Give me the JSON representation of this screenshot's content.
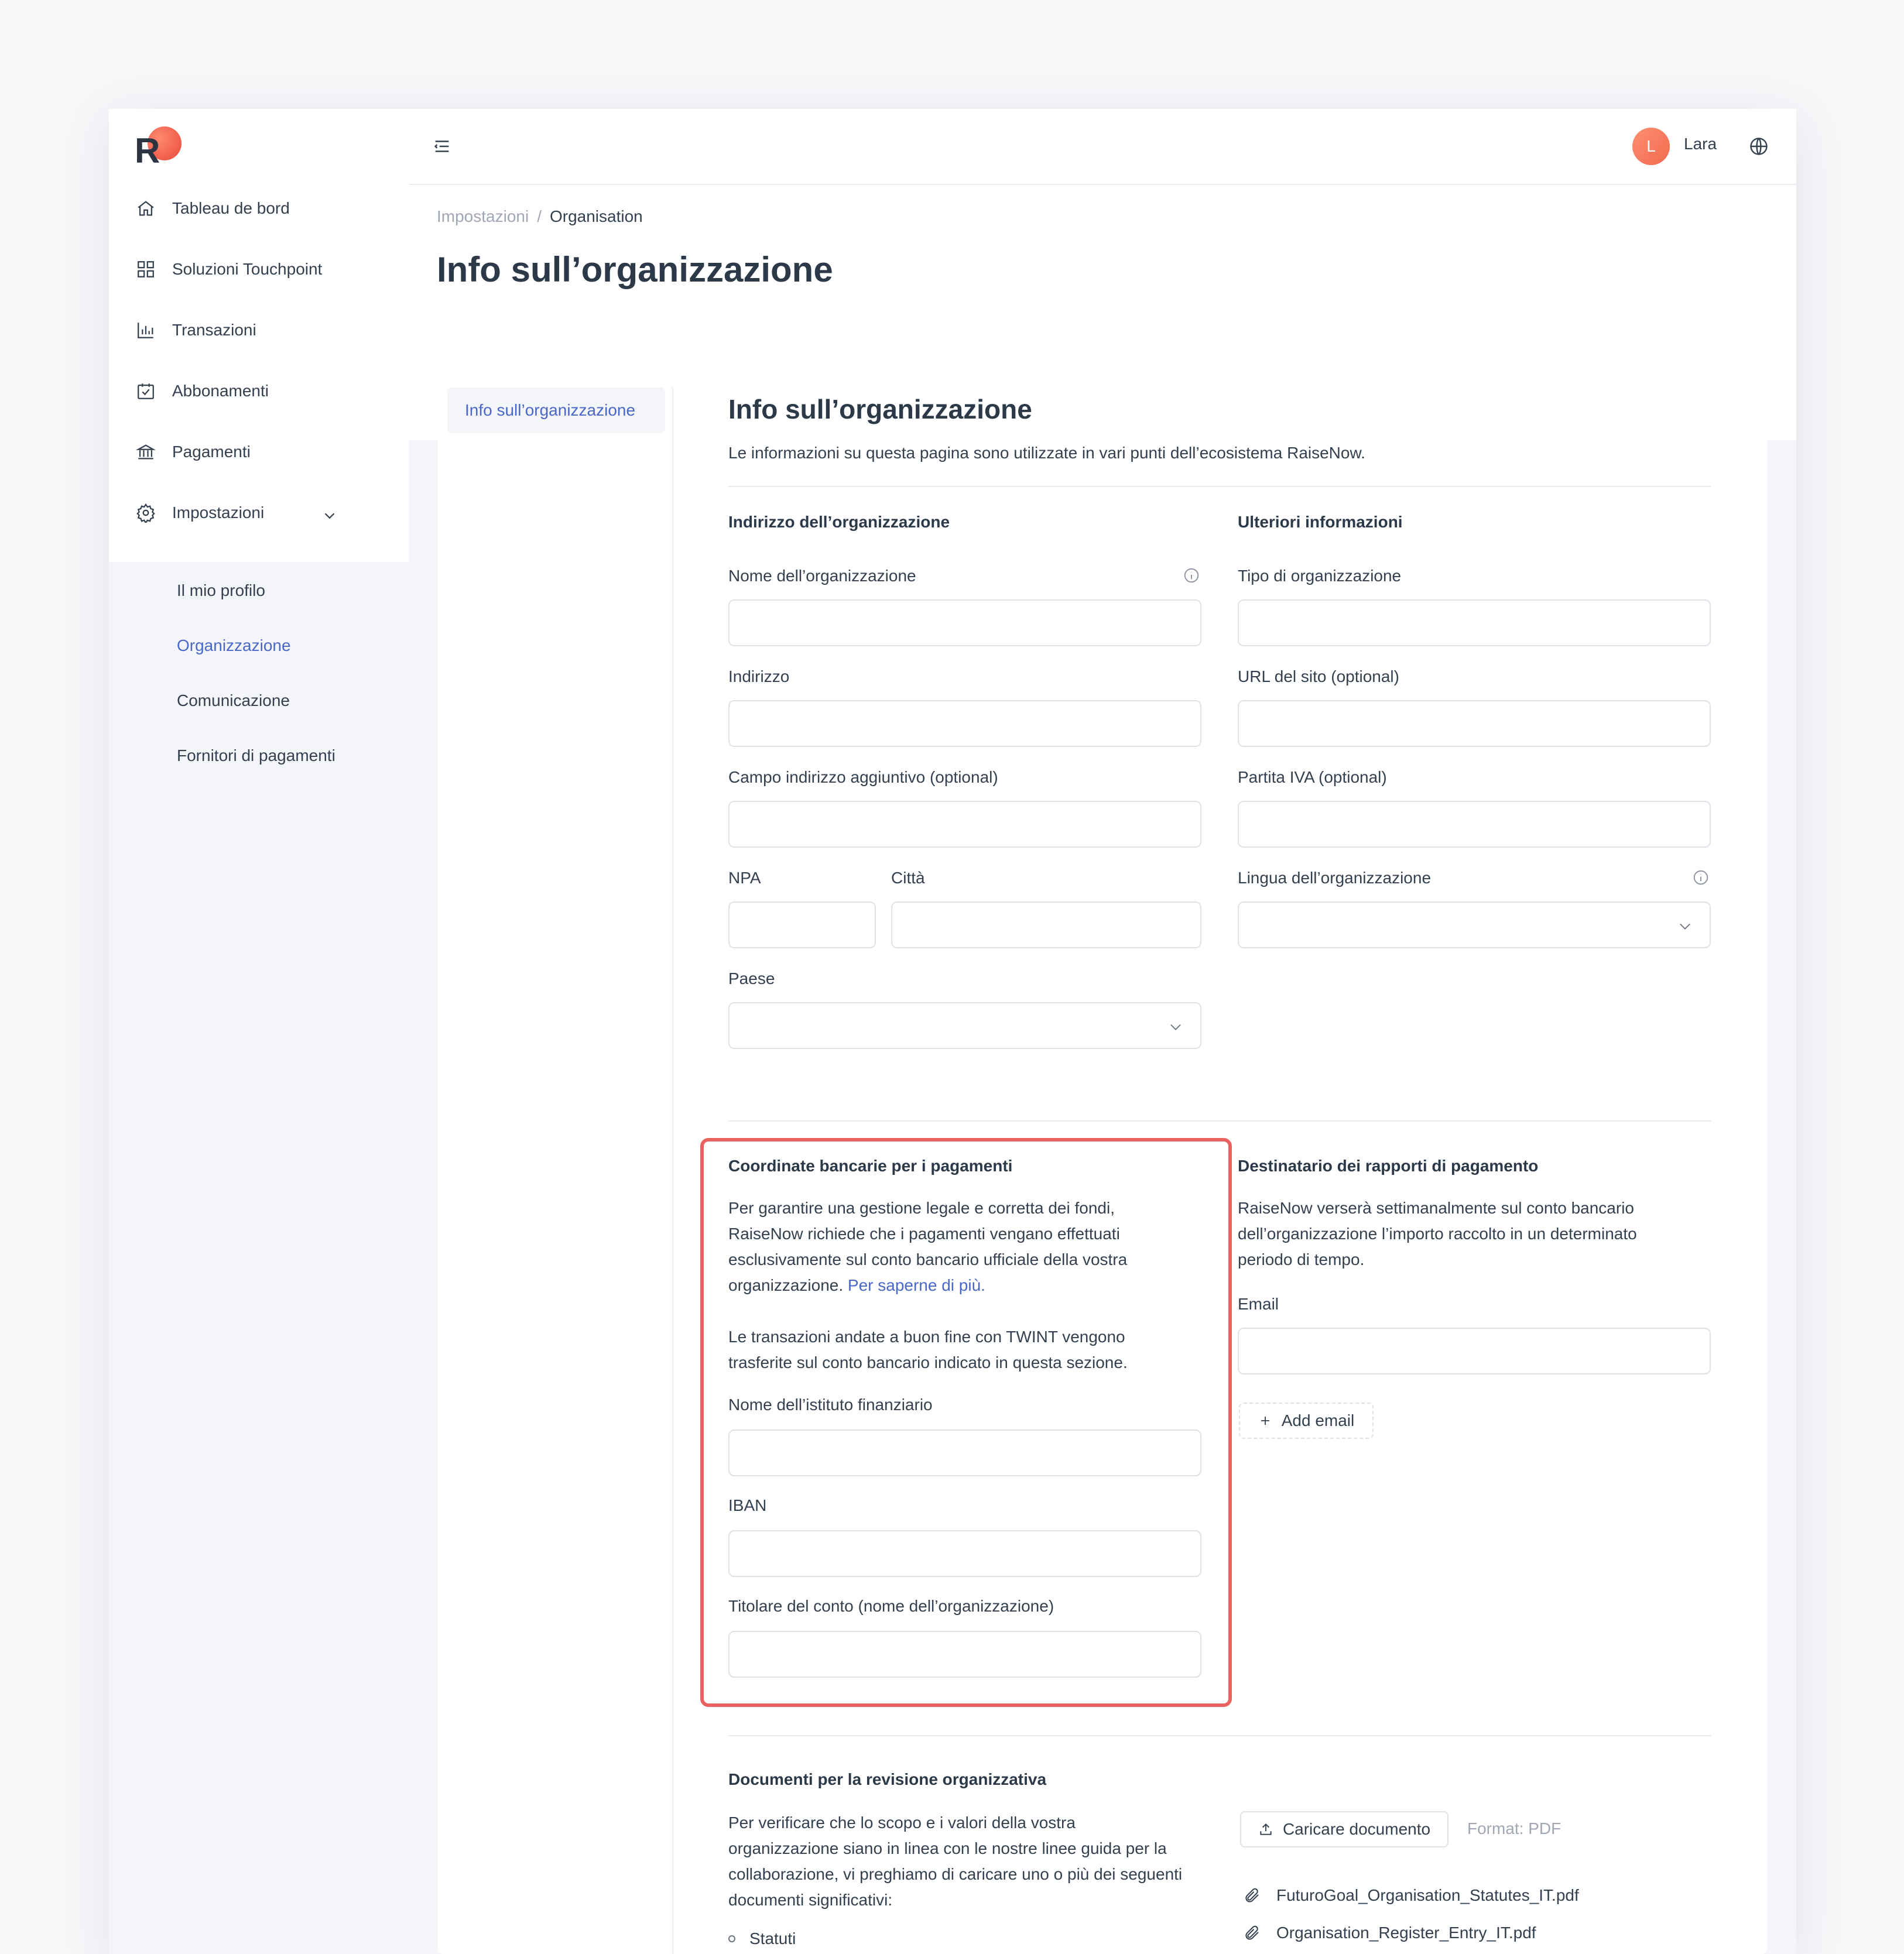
{
  "colors": {
    "accent": "#4a67c8",
    "highlight": "#e96160",
    "brand_gradient": [
      "#ff8a70",
      "#e8493b"
    ]
  },
  "logo": {
    "letter": "R"
  },
  "sidebar": {
    "items": [
      {
        "label": "Tableau de bord",
        "icon": "home-icon"
      },
      {
        "label": "Soluzioni Touchpoint",
        "icon": "grid-icon"
      },
      {
        "label": "Transazioni",
        "icon": "bar-chart-icon"
      },
      {
        "label": "Abbonamenti",
        "icon": "calendar-check-icon"
      },
      {
        "label": "Pagamenti",
        "icon": "bank-icon"
      },
      {
        "label": "Impostazioni",
        "icon": "gear-icon"
      }
    ],
    "sub_items": [
      {
        "label": "Il mio profilo"
      },
      {
        "label": "Organizzazione"
      },
      {
        "label": "Comunicazione"
      },
      {
        "label": "Fornitori di pagamenti"
      }
    ]
  },
  "topbar": {
    "avatar_initial": "L",
    "username": "Lara"
  },
  "breadcrumb": {
    "parent": "Impostazioni",
    "separator": "/",
    "current": "Organisation"
  },
  "page_title": "Info sull’organizzazione",
  "subnav": {
    "active": "Info sull’organizzazione"
  },
  "section": {
    "title": "Info sull’organizzazione",
    "description": "Le informazioni su questa pagina sono utilizzate in vari punti dell’ecosistema RaiseNow."
  },
  "address": {
    "heading": "Indirizzo dell’organizzazione",
    "name_label": "Nome dell’organizzazione",
    "address_label": "Indirizzo",
    "address2_label": "Campo indirizzo aggiuntivo (optional)",
    "zip_label": "NPA",
    "city_label": "Città",
    "country_label": "Paese"
  },
  "more_info": {
    "heading": "Ulteriori informazioni",
    "type_label": "Tipo di organizzazione",
    "url_label": "URL del sito (optional)",
    "vat_label": "Partita IVA (optional)",
    "language_label": "Lingua dell’organizzazione"
  },
  "bank": {
    "heading": "Coordinate bancarie per i pagamenti",
    "para1_lines": [
      "Per garantire una gestione legale e corretta dei fondi,",
      "RaiseNow richiede che i pagamenti vengano effettuati",
      "esclusivamente sul conto bancario ufficiale della vostra",
      "organizzazione."
    ],
    "learn_more": "Per saperne di più.",
    "para2_lines": [
      "Le transazioni andate a buon fine con TWINT vengono",
      "trasferite sul conto bancario indicato in questa sezione."
    ],
    "institution_label": "Nome dell’istituto finanziario",
    "iban_label": "IBAN",
    "holder_label": "Titolare del conto (nome dell’organizzazione)"
  },
  "reports": {
    "heading": "Destinatario dei rapporti di pagamento",
    "para_lines": [
      "RaiseNow verserà settimanalmente sul conto bancario",
      "dell’organizzazione l’importo raccolto in un determinato",
      "periodo di tempo."
    ],
    "email_label": "Email",
    "add_email": "Add email"
  },
  "documents": {
    "heading": "Documenti per la revisione organizzativa",
    "para_lines": [
      "Per verificare che lo scopo e i valori della vostra",
      "organizzazione siano in linea con le nostre linee guida per la",
      "collaborazione, vi preghiamo di caricare uno o più dei seguenti",
      "documenti significativi:"
    ],
    "bullet": "Statuti",
    "upload": "Caricare documento",
    "format": "Format: PDF",
    "files": [
      "FuturoGoal_Organisation_Statutes_IT.pdf",
      "Organisation_Register_Entry_IT.pdf"
    ]
  }
}
